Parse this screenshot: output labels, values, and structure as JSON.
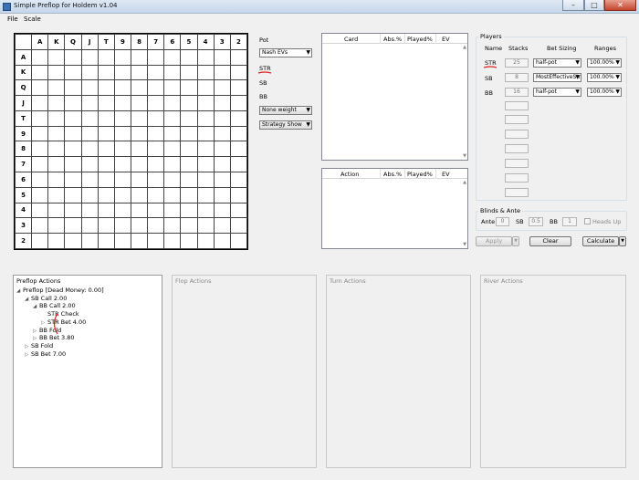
{
  "window": {
    "title": "Simple Preflop for Holdem v1.04"
  },
  "menu": [
    "File",
    "Scale"
  ],
  "grid": {
    "ranks": [
      "A",
      "K",
      "Q",
      "J",
      "T",
      "9",
      "8",
      "7",
      "6",
      "5",
      "4",
      "3",
      "2"
    ]
  },
  "controls": {
    "pot_label": "Pot",
    "ev_select": "Nash EVs",
    "str_label": "STR",
    "sb_label": "SB",
    "bb_label": "BB",
    "weight_select": "None weight",
    "strategy_select": "Strategy Show"
  },
  "card_table": {
    "headers": [
      "Card",
      "Abs.%",
      "Played%",
      "EV"
    ]
  },
  "action_table": {
    "headers": [
      "Action",
      "Abs.%",
      "Played%",
      "EV"
    ]
  },
  "players": {
    "title": "Players",
    "headers": [
      "Name",
      "Stacks",
      "Bet Sizing",
      "Ranges"
    ],
    "rows": [
      {
        "name": "STR",
        "stack": "25",
        "bet": "half-pot",
        "range": "100.00%"
      },
      {
        "name": "SB",
        "stack": "8",
        "bet": "MostEffectiveStr",
        "range": "100.00%"
      },
      {
        "name": "BB",
        "stack": "16",
        "bet": "half-pot",
        "range": "100.00%"
      }
    ],
    "accent_color": "#e02020"
  },
  "blinds": {
    "title": "Blinds & Ante",
    "ante_label": "Ante",
    "ante": "0",
    "sb_label": "SB",
    "sb": "0.5",
    "bb_label": "BB",
    "bb": "1",
    "heads_up": "Heads Up"
  },
  "buttons": {
    "apply": "Apply",
    "clear": "Clear",
    "calculate": "Calculate"
  },
  "panels": {
    "preflop": "Preflop Actions",
    "flop": "Flop Actions",
    "turn": "Turn Actions",
    "river": "River Actions"
  },
  "tree": [
    {
      "label": "Preflop [Dead Money: 0.00]",
      "arrow": "◢",
      "level": 0
    },
    {
      "label": "SB Call 2.00",
      "arrow": "◢",
      "level": 1
    },
    {
      "label": "BB Call 2.00",
      "arrow": "◢",
      "level": 2
    },
    {
      "label": "STR Check",
      "arrow": "",
      "level": 3
    },
    {
      "label": "STR Bet 4.00",
      "arrow": "▷",
      "level": 3
    },
    {
      "label": "BB Fold",
      "arrow": "▷",
      "level": 2
    },
    {
      "label": "BB Bet 3.80",
      "arrow": "▷",
      "level": 2
    },
    {
      "label": "SB Fold",
      "arrow": "▷",
      "level": 1
    },
    {
      "label": "SB Bet 7.00",
      "arrow": "▷",
      "level": 1
    }
  ]
}
